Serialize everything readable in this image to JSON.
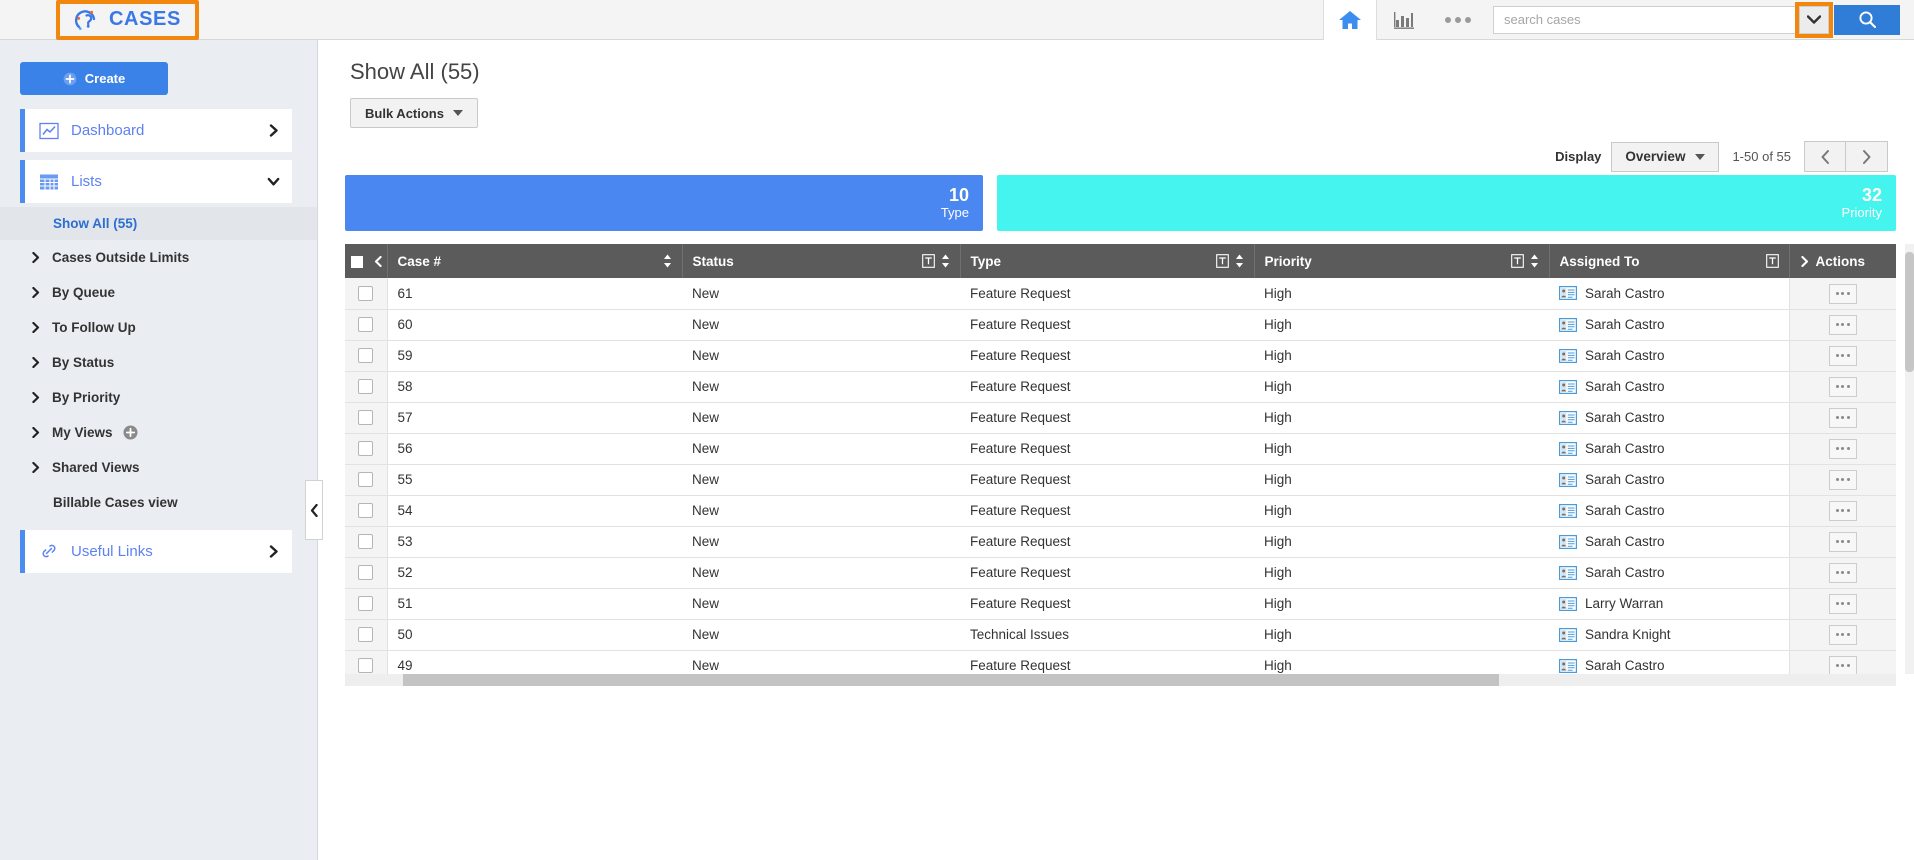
{
  "app": {
    "logo_text": "CASES",
    "accent_blue": "#3b82e8",
    "highlight_orange": "#f2870d"
  },
  "topbar": {
    "home_title": "Home",
    "reports_title": "Reports",
    "more_title": "More",
    "search_placeholder": "search cases",
    "search_value": "",
    "search_button_title": "Search",
    "search_dropdown_title": "Search options"
  },
  "sidebar": {
    "create_label": "Create",
    "main_items": [
      {
        "label": "Dashboard",
        "icon": "chart-line-icon",
        "state": "collapsed"
      },
      {
        "label": "Lists",
        "icon": "grid-icon",
        "state": "expanded"
      }
    ],
    "list_items": [
      {
        "label": "Show All (55)",
        "active": true,
        "has_chevron": false
      },
      {
        "label": "Cases Outside Limits",
        "active": false,
        "has_chevron": true
      },
      {
        "label": "By Queue",
        "active": false,
        "has_chevron": true
      },
      {
        "label": "To Follow Up",
        "active": false,
        "has_chevron": true
      },
      {
        "label": "By Status",
        "active": false,
        "has_chevron": true
      },
      {
        "label": "By Priority",
        "active": false,
        "has_chevron": true
      },
      {
        "label": "My Views",
        "active": false,
        "has_chevron": true,
        "add_button": true
      },
      {
        "label": "Shared Views",
        "active": false,
        "has_chevron": true
      },
      {
        "label": "Billable Cases view",
        "active": false,
        "has_chevron": false
      }
    ],
    "useful_links": {
      "label": "Useful Links",
      "icon": "link-icon"
    },
    "collapse_title": "Collapse sidebar"
  },
  "main": {
    "page_title": "Show All (55)",
    "bulk_actions_label": "Bulk Actions",
    "display_label": "Display",
    "display_value": "Overview",
    "range_label": "1-50 of 55",
    "prev_title": "Previous page",
    "next_title": "Next page"
  },
  "tiles": [
    {
      "number": "10",
      "label": "Type",
      "color": "#4a87f0",
      "width_pct": 45
    },
    {
      "number": "32",
      "label": "Priority",
      "color": "#45f4ee",
      "width_pct": 55
    }
  ],
  "table": {
    "columns": [
      {
        "key": "case",
        "label": "Case #",
        "sortable": true,
        "filterable": false
      },
      {
        "key": "status",
        "label": "Status",
        "sortable": true,
        "filterable": true
      },
      {
        "key": "type",
        "label": "Type",
        "sortable": true,
        "filterable": true
      },
      {
        "key": "priority",
        "label": "Priority",
        "sortable": true,
        "filterable": true
      },
      {
        "key": "assigned",
        "label": "Assigned To",
        "sortable": false,
        "filterable": true
      },
      {
        "key": "actions",
        "label": "Actions",
        "sortable": false,
        "filterable": false
      }
    ],
    "rows": [
      {
        "case": "61",
        "status": "New",
        "type": "Feature Request",
        "priority": "High",
        "assigned": "Sarah Castro"
      },
      {
        "case": "60",
        "status": "New",
        "type": "Feature Request",
        "priority": "High",
        "assigned": "Sarah Castro"
      },
      {
        "case": "59",
        "status": "New",
        "type": "Feature Request",
        "priority": "High",
        "assigned": "Sarah Castro"
      },
      {
        "case": "58",
        "status": "New",
        "type": "Feature Request",
        "priority": "High",
        "assigned": "Sarah Castro"
      },
      {
        "case": "57",
        "status": "New",
        "type": "Feature Request",
        "priority": "High",
        "assigned": "Sarah Castro"
      },
      {
        "case": "56",
        "status": "New",
        "type": "Feature Request",
        "priority": "High",
        "assigned": "Sarah Castro"
      },
      {
        "case": "55",
        "status": "New",
        "type": "Feature Request",
        "priority": "High",
        "assigned": "Sarah Castro"
      },
      {
        "case": "54",
        "status": "New",
        "type": "Feature Request",
        "priority": "High",
        "assigned": "Sarah Castro"
      },
      {
        "case": "53",
        "status": "New",
        "type": "Feature Request",
        "priority": "High",
        "assigned": "Sarah Castro"
      },
      {
        "case": "52",
        "status": "New",
        "type": "Feature Request",
        "priority": "High",
        "assigned": "Sarah Castro"
      },
      {
        "case": "51",
        "status": "New",
        "type": "Feature Request",
        "priority": "High",
        "assigned": "Larry Warran"
      },
      {
        "case": "50",
        "status": "New",
        "type": "Technical Issues",
        "priority": "High",
        "assigned": "Sandra Knight"
      },
      {
        "case": "49",
        "status": "New",
        "type": "Feature Request",
        "priority": "High",
        "assigned": "Sarah Castro"
      }
    ]
  }
}
